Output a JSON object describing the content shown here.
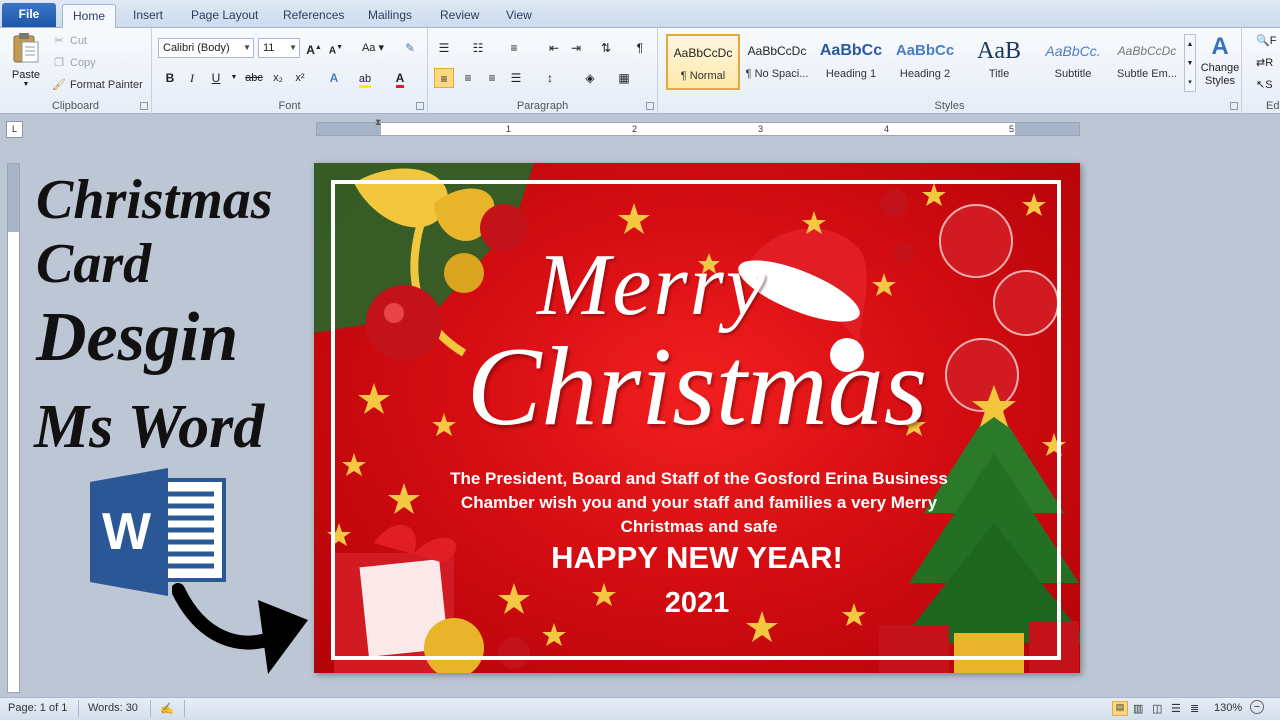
{
  "tabs": [
    "File",
    "Home",
    "Insert",
    "Page Layout",
    "References",
    "Mailings",
    "Review",
    "View"
  ],
  "clipboard": {
    "paste_label": "Paste",
    "cut_label": "Cut",
    "copy_label": "Copy",
    "format_painter_label": "Format Painter",
    "group_label": "Clipboard"
  },
  "font": {
    "family": "Calibri (Body)",
    "size": "11",
    "group_label": "Font",
    "buttons": [
      "B",
      "I",
      "U",
      "abc",
      "x₂",
      "x²"
    ]
  },
  "paragraph": {
    "group_label": "Paragraph"
  },
  "styles": {
    "group_label": "Styles",
    "items": [
      {
        "preview": "AaBbCcDc",
        "name": "¶ Normal"
      },
      {
        "preview": "AaBbCcDc",
        "name": "¶ No Spaci..."
      },
      {
        "preview": "AaBbCc",
        "name": "Heading 1"
      },
      {
        "preview": "AaBbCc",
        "name": "Heading 2"
      },
      {
        "preview": "AaB",
        "name": "Title"
      },
      {
        "preview": "AaBbCc.",
        "name": "Subtitle"
      },
      {
        "preview": "AaBbCcDc",
        "name": "Subtle Em..."
      }
    ],
    "change_styles_label": "Change Styles",
    "editing_partial": "Ed"
  },
  "ruler": {
    "numbers": [
      "1",
      "2",
      "3",
      "4",
      "5"
    ]
  },
  "overlay": {
    "line1": "Christmas",
    "line2": "Card",
    "line3": "Desgin",
    "line4": "Ms Word",
    "logo_letter": "W"
  },
  "card": {
    "merry": "Merry",
    "christmas": "Christmas",
    "message": "The President, Board and Staff of the Gosford Erina Business Chamber wish you and your staff and families a very Merry Christmas and safe",
    "happy": "HAPPY NEW YEAR!",
    "year": "2021"
  },
  "status": {
    "page": "Page: 1 of 1",
    "words": "Words: 30",
    "zoom": "130%"
  },
  "colors": {
    "card_red": "#d40d12",
    "word_blue": "#2b5797",
    "file_tab": "#1e56a8"
  }
}
